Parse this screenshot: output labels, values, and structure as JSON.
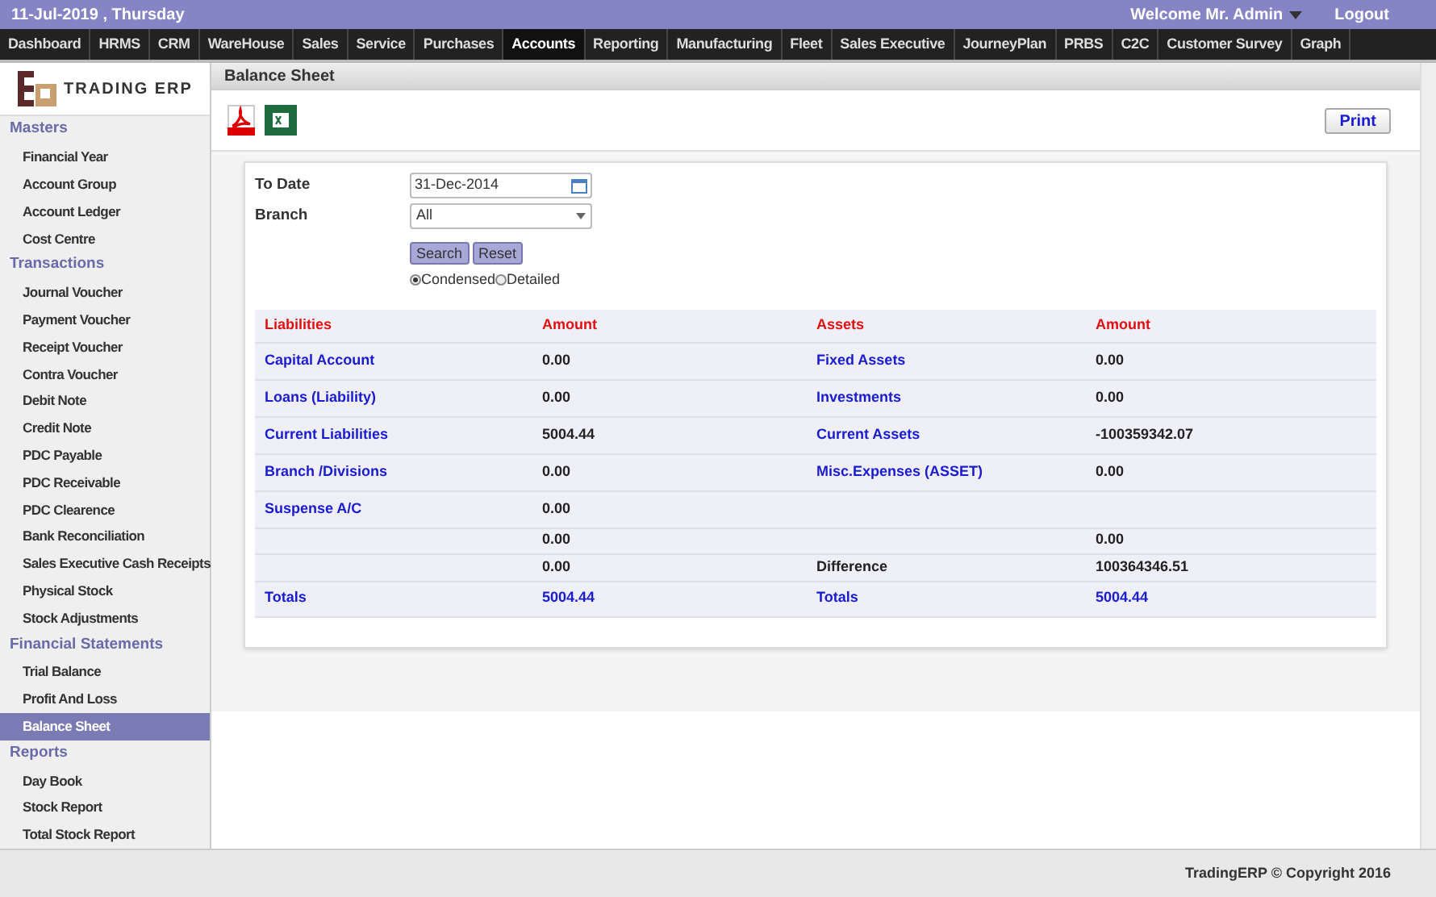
{
  "top_bar": {
    "date": "11-Jul-2019 , Thursday",
    "welcome": "Welcome Mr. Admin",
    "logout": "Logout"
  },
  "nav": [
    {
      "label": "Dashboard",
      "selected": false
    },
    {
      "label": "HRMS",
      "selected": false
    },
    {
      "label": "CRM",
      "selected": false
    },
    {
      "label": "WareHouse",
      "selected": false
    },
    {
      "label": "Sales",
      "selected": false
    },
    {
      "label": "Service",
      "selected": false
    },
    {
      "label": "Purchases",
      "selected": false
    },
    {
      "label": "Accounts",
      "selected": true
    },
    {
      "label": "Reporting",
      "selected": false
    },
    {
      "label": "Manufacturing",
      "selected": false
    },
    {
      "label": "Fleet",
      "selected": false
    },
    {
      "label": "Sales Executive",
      "selected": false
    },
    {
      "label": "JourneyPlan",
      "selected": false
    },
    {
      "label": "PRBS",
      "selected": false
    },
    {
      "label": "C2C",
      "selected": false
    },
    {
      "label": "Customer Survey",
      "selected": false
    },
    {
      "label": "Graph",
      "selected": false
    }
  ],
  "logo": {
    "text": "TRADING ERP"
  },
  "sidebar": [
    {
      "heading": "Masters",
      "items": [
        {
          "label": "Financial Year",
          "selected": false
        },
        {
          "label": "Account Group",
          "selected": false
        },
        {
          "label": "Account Ledger",
          "selected": false
        },
        {
          "label": "Cost Centre",
          "selected": false
        }
      ]
    },
    {
      "heading": "Transactions",
      "items": [
        {
          "label": "Journal Voucher",
          "selected": false
        },
        {
          "label": "Payment Voucher",
          "selected": false
        },
        {
          "label": "Receipt Voucher",
          "selected": false
        },
        {
          "label": "Contra Voucher",
          "selected": false
        },
        {
          "label": "Debit Note",
          "selected": false
        },
        {
          "label": "Credit Note",
          "selected": false
        },
        {
          "label": "PDC Payable",
          "selected": false
        },
        {
          "label": "PDC Receivable",
          "selected": false
        },
        {
          "label": "PDC Clearence",
          "selected": false
        },
        {
          "label": "Bank Reconciliation",
          "selected": false
        },
        {
          "label": "Sales Executive Cash Receipts",
          "selected": false
        },
        {
          "label": "Physical Stock",
          "selected": false
        },
        {
          "label": "Stock Adjustments",
          "selected": false
        }
      ]
    },
    {
      "heading": "Financial Statements",
      "items": [
        {
          "label": "Trial Balance",
          "selected": false
        },
        {
          "label": "Profit And Loss",
          "selected": false
        },
        {
          "label": "Balance Sheet",
          "selected": true
        }
      ]
    },
    {
      "heading": "Reports",
      "items": [
        {
          "label": "Day Book",
          "selected": false
        },
        {
          "label": "Stock Report",
          "selected": false
        },
        {
          "label": "Total Stock Report",
          "selected": false
        }
      ]
    }
  ],
  "page_title": "Balance Sheet",
  "print_button": "Print",
  "form": {
    "to_date_label": "To Date",
    "to_date": "31-Dec-2014",
    "branch_label": "Branch",
    "branch": "All",
    "search_button": "Search",
    "reset_button": "Reset",
    "view_options": [
      {
        "label": "Condensed",
        "selected": true
      },
      {
        "label": "Detailed",
        "selected": false
      }
    ]
  },
  "table": {
    "columns": [
      "Liabilities",
      "Amount",
      "Assets",
      "Amount"
    ],
    "rows": [
      {
        "kind": "item",
        "liability": "Capital Account",
        "liability_amount": "0.00",
        "asset": "Fixed Assets",
        "asset_amount": "0.00"
      },
      {
        "kind": "item",
        "liability": "Loans (Liability)",
        "liability_amount": "0.00",
        "asset": "Investments",
        "asset_amount": "0.00"
      },
      {
        "kind": "item",
        "liability": "Current Liabilities",
        "liability_amount": "5004.44",
        "asset": "Current Assets",
        "asset_amount": "-100359342.07"
      },
      {
        "kind": "item",
        "liability": "Branch /Divisions",
        "liability_amount": "0.00",
        "asset": "Misc.Expenses (ASSET)",
        "asset_amount": "0.00"
      },
      {
        "kind": "item",
        "liability": "Suspense A/C",
        "liability_amount": "0.00"
      },
      {
        "kind": "subtotal",
        "liability_amount": "0.00",
        "asset_amount": "0.00"
      },
      {
        "kind": "difference",
        "liability_amount": "0.00",
        "asset": "Difference",
        "asset_amount": "100364346.51"
      },
      {
        "kind": "total",
        "liability": "Totals",
        "liability_amount": "5004.44",
        "asset": "Totals",
        "asset_amount": "5004.44"
      }
    ]
  },
  "footer": "TradingERP © Copyright 2016"
}
